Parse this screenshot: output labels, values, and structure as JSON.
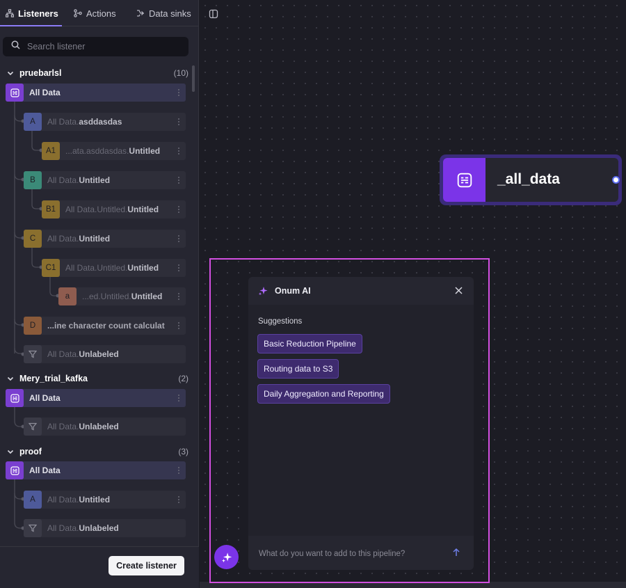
{
  "tabs": [
    {
      "label": "Listeners",
      "icon": "hierarchy-icon",
      "active": true
    },
    {
      "label": "Actions",
      "icon": "branch-icon",
      "active": false
    },
    {
      "label": "Data sinks",
      "icon": "sink-icon",
      "active": false
    }
  ],
  "search": {
    "placeholder": "Search listener"
  },
  "groups": [
    {
      "name": "pruebarlsl",
      "count": "(10)",
      "root": {
        "pre": "",
        "post": "All Data"
      },
      "children": [
        {
          "badge": "A",
          "pre": "All Data.",
          "post": "asddasdas"
        },
        {
          "badge": "A1",
          "pre": "...ata.asddasdas.",
          "post": "Untitled"
        },
        {
          "badge": "B",
          "pre": "All Data.",
          "post": "Untitled"
        },
        {
          "badge": "B1",
          "pre": "All Data.Untitled.",
          "post": "Untitled"
        },
        {
          "badge": "C",
          "pre": "All Data.",
          "post": "Untitled"
        },
        {
          "badge": "C1",
          "pre": "All Data.Untitled.",
          "post": "Untitled"
        },
        {
          "badge": "a",
          "pre": "...ed.Untitled.",
          "post": "Untitled"
        },
        {
          "badge": "D",
          "pre": "",
          "post": "...ine character count calculat"
        },
        {
          "badge": "",
          "pre": "All Data.",
          "post": "Unlabeled"
        }
      ]
    },
    {
      "name": "Mery_trial_kafka",
      "count": "(2)",
      "root": {
        "pre": "",
        "post": "All Data"
      },
      "children": [
        {
          "badge": "",
          "pre": "All Data.",
          "post": "Unlabeled"
        }
      ]
    },
    {
      "name": "proof",
      "count": "(3)",
      "root": {
        "pre": "",
        "post": "All Data"
      },
      "children": [
        {
          "badge": "A",
          "pre": "All Data.",
          "post": "Untitled"
        },
        {
          "badge": "",
          "pre": "All Data.",
          "post": "Unlabeled"
        }
      ]
    }
  ],
  "create_button": "Create listener",
  "canvas_node": {
    "title": "_all_data"
  },
  "ai": {
    "title": "Onum AI",
    "suggestions_label": "Suggestions",
    "suggestions": [
      "Basic Reduction Pipeline",
      "Routing data to S3",
      "Daily Aggregation and Reporting"
    ],
    "input_placeholder": "What do you want to add to this pipeline?"
  },
  "colors": {
    "accent": "#7b34e8",
    "outline": "#d24fe0",
    "tab_underline": "#8b7cf6"
  }
}
